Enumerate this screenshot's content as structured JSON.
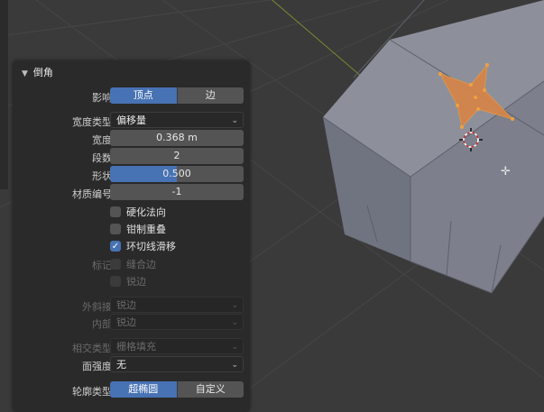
{
  "panel": {
    "title": "倒角",
    "affect": {
      "label": "影响",
      "options": [
        "顶点",
        "边"
      ],
      "selected": 0
    },
    "width_type": {
      "label": "宽度类型",
      "value": "偏移量"
    },
    "width": {
      "label": "宽度",
      "value": "0.368 m"
    },
    "segments": {
      "label": "段数",
      "value": "2"
    },
    "shape": {
      "label": "形状",
      "value": "0.500",
      "fraction": 0.5
    },
    "material": {
      "label": "材质编号",
      "value": "-1"
    },
    "harden_normals": {
      "label": "硬化法向",
      "checked": false
    },
    "clamp_overlap": {
      "label": "钳制重叠",
      "checked": false
    },
    "loop_slide": {
      "label": "环切线滑移",
      "checked": true
    },
    "mark": {
      "label": "标记",
      "seam": "缝合边",
      "sharp": "锐边"
    },
    "miter_outer": {
      "label": "外斜接",
      "value": "锐边"
    },
    "miter_inner": {
      "label": "内部",
      "value": "锐边"
    },
    "intersection": {
      "label": "相交类型",
      "value": "栅格填充"
    },
    "face_strength": {
      "label": "面强度",
      "value": "无"
    },
    "profile_type": {
      "label": "轮廓类型",
      "options": [
        "超椭圆",
        "自定义"
      ],
      "selected": 0
    }
  },
  "colors": {
    "accent": "#4772b3",
    "mesh_face": "#8c8f9a",
    "selection": "#e08a3c"
  }
}
